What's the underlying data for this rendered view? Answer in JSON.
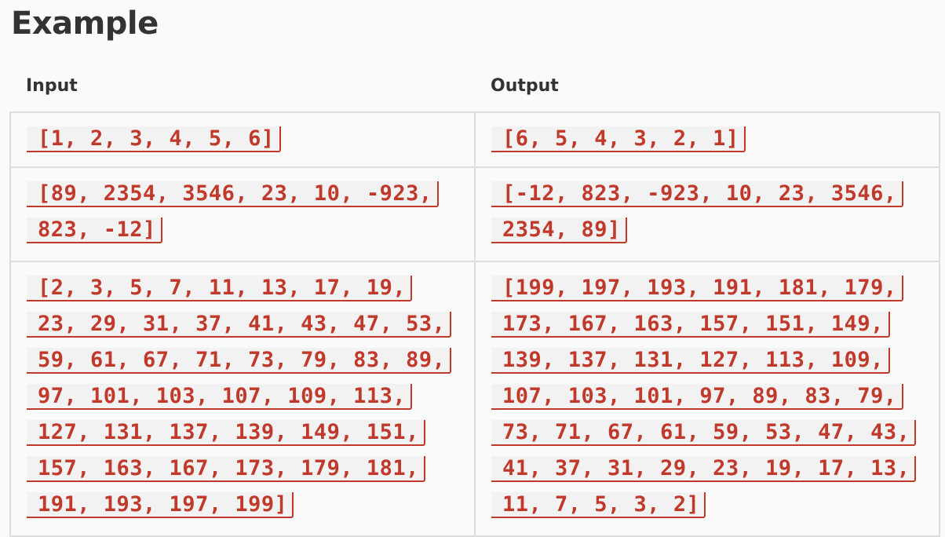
{
  "heading": "Example",
  "table": {
    "headers": {
      "input": "Input",
      "output": "Output"
    },
    "rows": [
      {
        "input": "[1, 2, 3, 4, 5, 6]",
        "output": "[6, 5, 4, 3, 2, 1]"
      },
      {
        "input": "[89, 2354, 3546, 23, 10, -923, 823, -12]",
        "output": "[-12, 823, -923, 10, 23, 3546, 2354, 89]"
      },
      {
        "input": "[2, 3, 5, 7, 11, 13, 17, 19, 23, 29, 31, 37, 41, 43, 47, 53, 59, 61, 67, 71, 73, 79, 83, 89, 97, 101, 103, 107, 109, 113, 127, 131, 137, 139, 149, 151, 157, 163, 167, 173, 179, 181, 191, 193, 197, 199]",
        "output": "[199, 197, 193, 191, 181, 179, 173, 167, 163, 157, 151, 149, 139, 137, 131, 127, 113, 109, 107, 103, 101, 97, 89, 83, 79, 73, 71, 67, 61, 59, 53, 47, 43, 41, 37, 31, 29, 23, 19, 17, 13, 11, 7, 5, 3, 2]"
      }
    ]
  },
  "colors": {
    "code_text": "#c0392b",
    "code_background": "#f2f2f2",
    "border": "#dddddd",
    "page_background": "#fafafa"
  }
}
